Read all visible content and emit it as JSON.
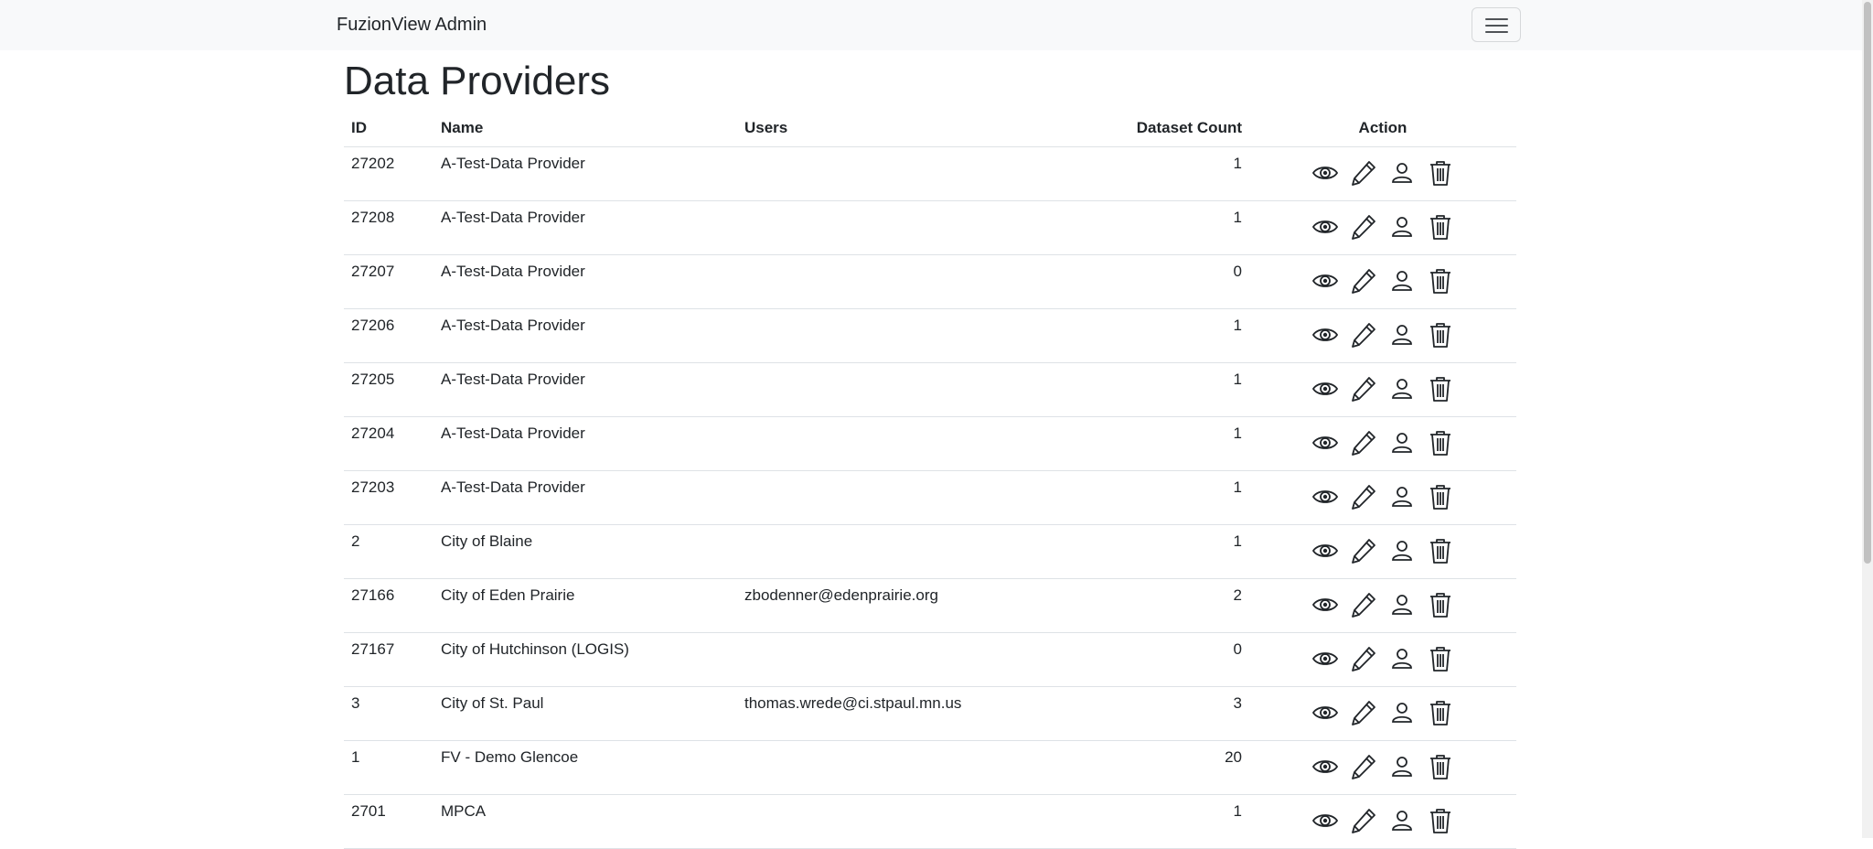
{
  "app": {
    "brand": "FuzionView Admin"
  },
  "page": {
    "title": "Data Providers"
  },
  "table": {
    "headers": {
      "id": "ID",
      "name": "Name",
      "users": "Users",
      "count": "Dataset Count",
      "action": "Action"
    },
    "rows": [
      {
        "id": "27202",
        "name": "A-Test-Data Provider",
        "users": "",
        "count": "1"
      },
      {
        "id": "27208",
        "name": "A-Test-Data Provider",
        "users": "",
        "count": "1"
      },
      {
        "id": "27207",
        "name": "A-Test-Data Provider",
        "users": "",
        "count": "0"
      },
      {
        "id": "27206",
        "name": "A-Test-Data Provider",
        "users": "",
        "count": "1"
      },
      {
        "id": "27205",
        "name": "A-Test-Data Provider",
        "users": "",
        "count": "1"
      },
      {
        "id": "27204",
        "name": "A-Test-Data Provider",
        "users": "",
        "count": "1"
      },
      {
        "id": "27203",
        "name": "A-Test-Data Provider",
        "users": "",
        "count": "1"
      },
      {
        "id": "2",
        "name": "City of Blaine",
        "users": "",
        "count": "1"
      },
      {
        "id": "27166",
        "name": "City of Eden Prairie",
        "users": "zbodenner@edenprairie.org",
        "count": "2"
      },
      {
        "id": "27167",
        "name": "City of Hutchinson (LOGIS)",
        "users": "",
        "count": "0"
      },
      {
        "id": "3",
        "name": "City of St. Paul",
        "users": "thomas.wrede@ci.stpaul.mn.us",
        "count": "3"
      },
      {
        "id": "1",
        "name": "FV - Demo Glencoe",
        "users": "",
        "count": "20"
      },
      {
        "id": "2701",
        "name": "MPCA",
        "users": "",
        "count": "1"
      }
    ]
  },
  "icons": {
    "view": "eye-icon",
    "edit": "pencil-icon",
    "users": "person-icon",
    "delete": "trash-icon",
    "menu": "hamburger-icon"
  }
}
